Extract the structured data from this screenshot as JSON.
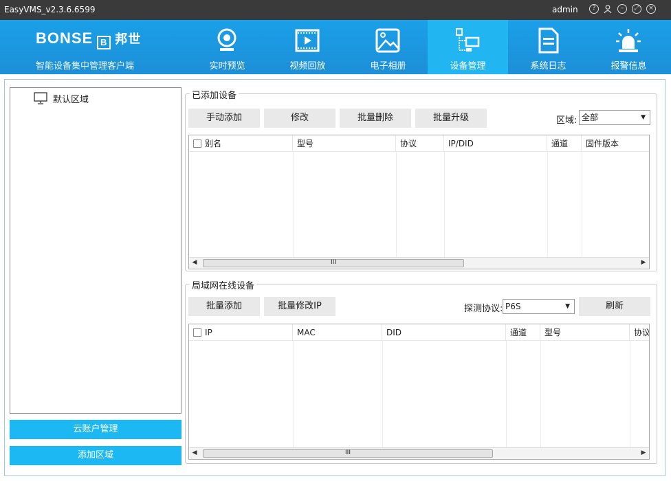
{
  "window": {
    "title": "EasyVMS_v2.3.6.6599",
    "user": "admin",
    "controls": [
      "help-icon",
      "user-icon",
      "minimize-icon",
      "restore-icon",
      "close-icon"
    ]
  },
  "brand": {
    "logo_text": "BONSE",
    "logo_mark": "B",
    "logo_cn": "邦世",
    "subtitle": "智能设备集中管理客户端"
  },
  "nav": [
    {
      "label": "实时预览",
      "icon": "camera-icon"
    },
    {
      "label": "视频回放",
      "icon": "video-play-icon"
    },
    {
      "label": "电子相册",
      "icon": "photo-album-icon"
    },
    {
      "label": "设备管理",
      "icon": "device-management-icon",
      "active": true
    },
    {
      "label": "系统日志",
      "icon": "document-icon"
    },
    {
      "label": "报警信息",
      "icon": "alarm-light-icon"
    }
  ],
  "tree": {
    "root_label": "默认区域"
  },
  "sidebar_buttons": {
    "cloud_account": "云账户管理",
    "add_area": "添加区域"
  },
  "added": {
    "title": "已添加设备",
    "buttons": {
      "manual_add": "手动添加",
      "modify": "修改",
      "batch_delete": "批量删除",
      "batch_upgrade": "批量升级"
    },
    "area_label": "区域:",
    "area_value": "全部",
    "columns": [
      "别名",
      "型号",
      "协议",
      "IP/DID",
      "通道",
      "固件版本"
    ],
    "scroll_mark": "III"
  },
  "lan": {
    "title": "局域网在线设备",
    "buttons": {
      "batch_add": "批量添加",
      "batch_modify_ip": "批量修改IP",
      "refresh": "刷新"
    },
    "protocol_label": "探测协议:",
    "protocol_value": "P6S",
    "columns": [
      "IP",
      "MAC",
      "DID",
      "通道",
      "型号",
      "协议"
    ],
    "scroll_mark": "III"
  },
  "colors": {
    "header": "#1c96de",
    "active_nav": "#21b6f2",
    "sidebar_button": "#1bb8f4",
    "titlebar": "#3a3a3a"
  }
}
